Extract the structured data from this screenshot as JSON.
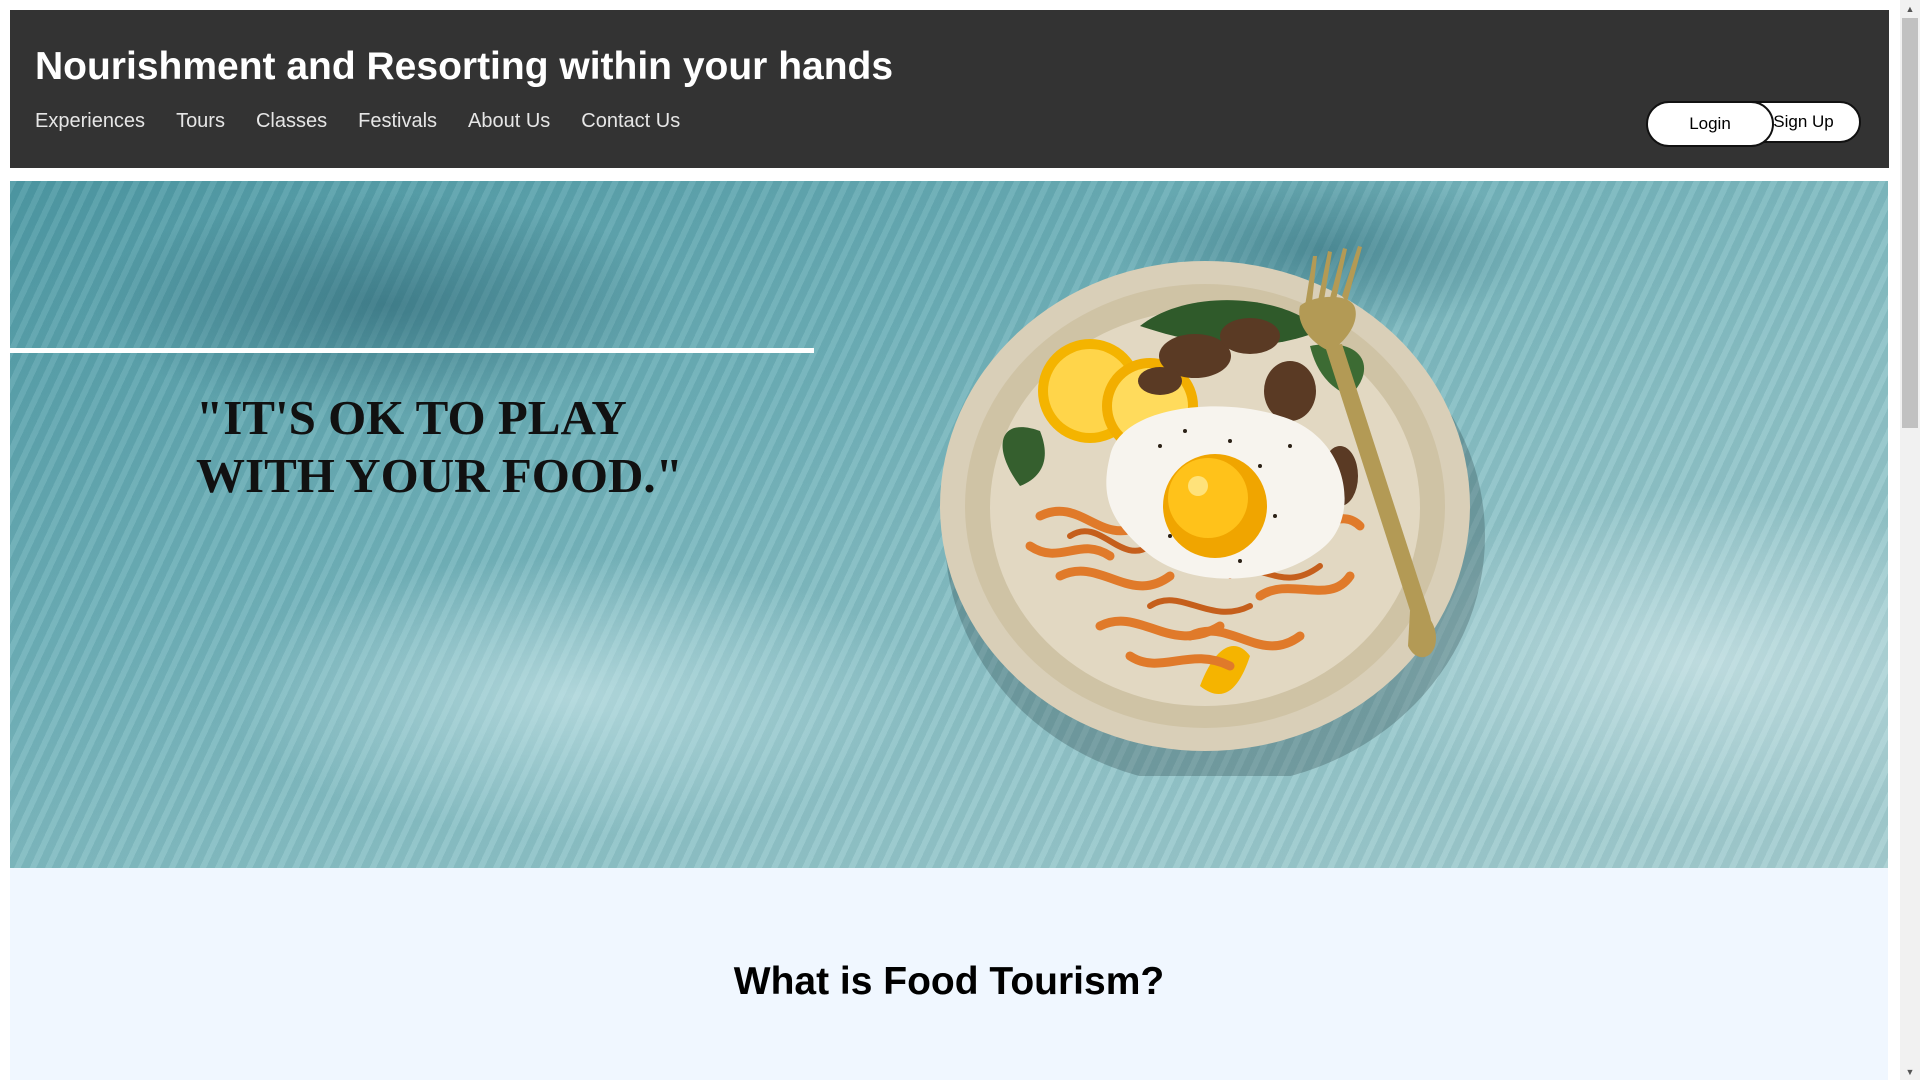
{
  "header": {
    "title": "Nourishment and Resorting within your hands",
    "nav": [
      "Experiences",
      "Tours",
      "Classes",
      "Festivals",
      "About Us",
      "Contact Us"
    ],
    "login_label": "Login",
    "signup_label": "Sign Up",
    "background_color": "#333333"
  },
  "hero": {
    "quote": "\"IT'S OK TO PLAY\nWITH YOUR FOOD.\"",
    "image": "plate-of-food-with-fried-egg-and-fork"
  },
  "section": {
    "heading": "What is Food Tourism?",
    "background_color": "#f0f7ff"
  },
  "scrollbar": {
    "up_icon": "triangle-up-icon",
    "down_icon": "triangle-down-icon"
  }
}
